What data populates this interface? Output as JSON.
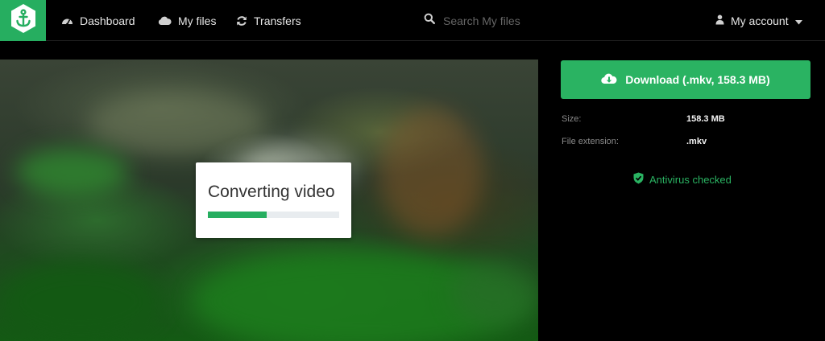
{
  "nav": {
    "items": [
      {
        "label": "Dashboard",
        "icon": "dashboard-icon"
      },
      {
        "label": "My files",
        "icon": "cloud-icon"
      },
      {
        "label": "Transfers",
        "icon": "refresh-icon"
      }
    ],
    "search_placeholder": "Search My files",
    "account_label": "My account"
  },
  "player": {
    "status_text": "Converting video",
    "progress_percent": 45
  },
  "sidebar": {
    "download_label": "Download (.mkv, 158.3 MB)",
    "size_label": "Size:",
    "size_value": "158.3 MB",
    "ext_label": "File extension:",
    "ext_value": ".mkv",
    "antivirus_label": "Antivirus checked"
  },
  "colors": {
    "brand": "#26ae60",
    "button": "#2ab362",
    "background": "#000000"
  }
}
